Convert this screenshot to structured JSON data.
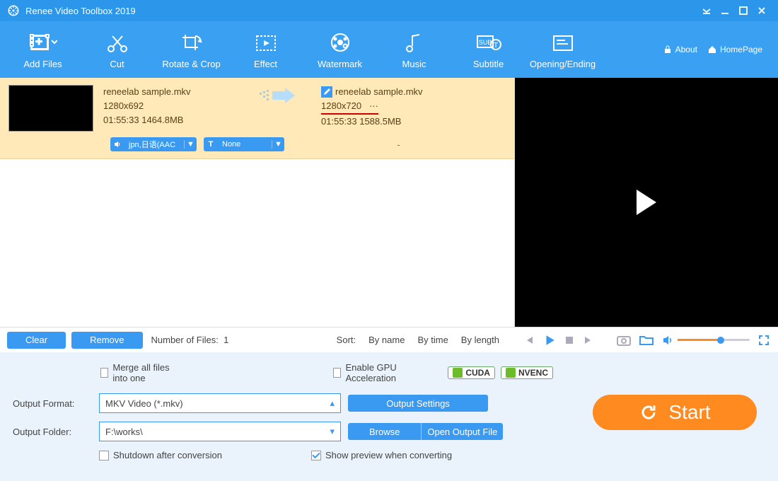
{
  "app_title": "Renee Video Toolbox 2019",
  "toolbar": [
    {
      "key": "add",
      "label": "Add Files"
    },
    {
      "key": "cut",
      "label": "Cut"
    },
    {
      "key": "rotate",
      "label": "Rotate & Crop"
    },
    {
      "key": "effect",
      "label": "Effect"
    },
    {
      "key": "watermark",
      "label": "Watermark"
    },
    {
      "key": "music",
      "label": "Music"
    },
    {
      "key": "subtitle",
      "label": "Subtitle"
    },
    {
      "key": "opening",
      "label": "Opening/Ending"
    }
  ],
  "header_links": {
    "about": "About",
    "homepage": "HomePage"
  },
  "file": {
    "src_name": "reneelab sample.mkv",
    "src_res": "1280x692",
    "src_meta": "01:55:33 1464.8MB",
    "dst_name": "reneelab sample.mkv",
    "dst_res": "1280x720",
    "dst_res_more": "···",
    "dst_meta": "01:55:33 1588.5MB",
    "audio_track": "jpn,日语(AAC",
    "sub_track": "None",
    "extra": "-"
  },
  "list_footer": {
    "clear": "Clear",
    "remove": "Remove",
    "count_label": "Number of Files:",
    "count": "1",
    "sort_label": "Sort:",
    "sort_name": "By name",
    "sort_time": "By time",
    "sort_length": "By length"
  },
  "bottom": {
    "merge": "Merge all files into one",
    "gpu": "Enable GPU Acceleration",
    "cuda": "CUDA",
    "nvenc": "NVENC",
    "format_label": "Output Format:",
    "format_value": "MKV Video (*.mkv)",
    "output_settings": "Output Settings",
    "folder_label": "Output Folder:",
    "folder_value": "F:\\works\\",
    "browse": "Browse",
    "open_folder": "Open Output File",
    "shutdown": "Shutdown after conversion",
    "preview": "Show preview when converting",
    "start": "Start"
  },
  "colors": {
    "primary": "#3a9af2",
    "accent": "#ff8a1f",
    "highlight_row": "#ffe9b8"
  }
}
